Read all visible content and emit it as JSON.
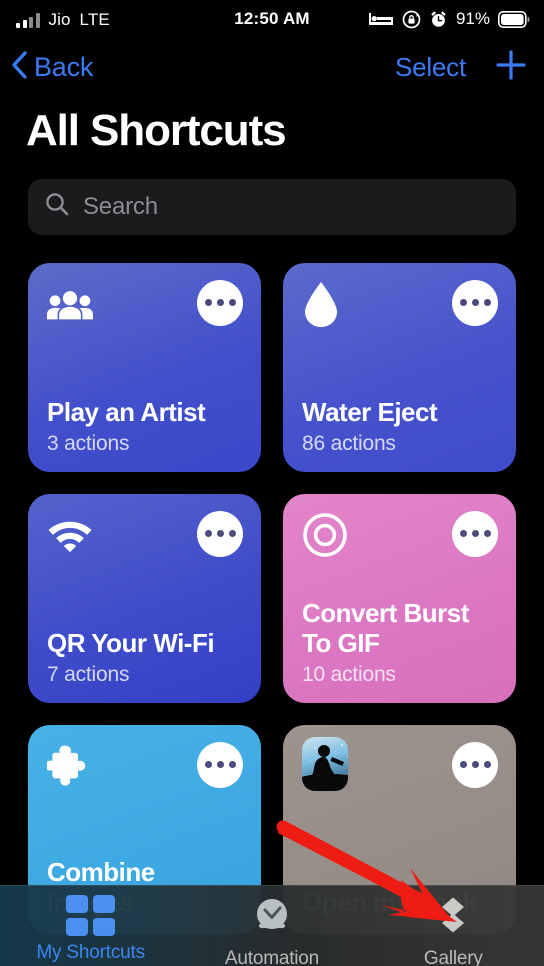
{
  "status_bar": {
    "carrier": "Jio",
    "network": "LTE",
    "time": "12:50 AM",
    "battery_percent": "91%",
    "icons": [
      "signal-bars-icon",
      "bed-icon",
      "rotation-lock-icon",
      "alarm-clock-icon",
      "battery-icon"
    ]
  },
  "nav": {
    "back_label": "Back",
    "select_label": "Select",
    "add_label": "+"
  },
  "header": {
    "title": "All Shortcuts"
  },
  "search": {
    "placeholder": "Search",
    "value": ""
  },
  "shortcuts": [
    {
      "name": "Play an Artist",
      "actions": "3 actions",
      "icon": "people-icon",
      "color_top": "#5c6bc6",
      "color_bottom": "#3b47c8"
    },
    {
      "name": "Water Eject",
      "actions": "86 actions",
      "icon": "water-drop-icon",
      "color_top": "#5a69c9",
      "color_bottom": "#3f4cca"
    },
    {
      "name": "QR Your Wi-Fi",
      "actions": "7 actions",
      "icon": "wifi-icon",
      "color_top": "#5361cb",
      "color_bottom": "#3340c6"
    },
    {
      "name": "Convert Burst To GIF",
      "actions": "10 actions",
      "icon": "concentric-circles-icon",
      "color_top": "#e283ca",
      "color_bottom": "#d76fbc"
    },
    {
      "name": "Combine Images",
      "actions": "",
      "icon": "puzzle-piece-icon",
      "color_top": "#45b0e6",
      "color_bottom": "#3aa5e0"
    },
    {
      "name": "Open my book",
      "actions": "",
      "icon": "kindle-app-icon",
      "color_top": "#9b918c",
      "color_bottom": "#958b86"
    }
  ],
  "tabs": [
    {
      "label": "My Shortcuts",
      "icon": "grid-squares-icon",
      "active": true
    },
    {
      "label": "Automation",
      "icon": "clock-icon",
      "active": false
    },
    {
      "label": "Gallery",
      "icon": "layers-icon",
      "active": false
    }
  ],
  "annotation": {
    "type": "red-arrow",
    "points_to": "Gallery",
    "color": "#ee1c12"
  }
}
